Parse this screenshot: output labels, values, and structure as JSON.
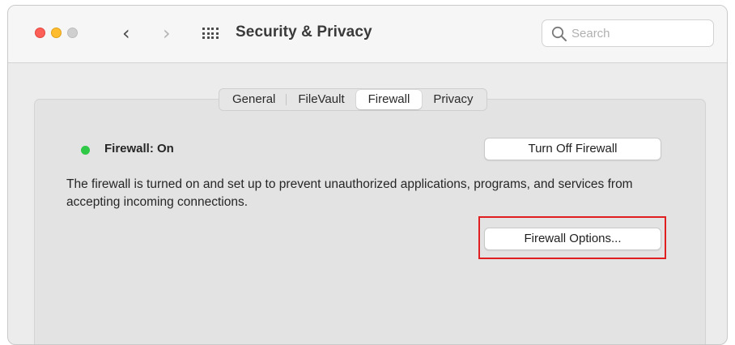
{
  "window": {
    "title": "Security & Privacy"
  },
  "toolbar": {
    "back_icon": "chevron-left-icon",
    "forward_icon": "chevron-right-icon",
    "show_all_icon": "grid-icon",
    "search": {
      "placeholder": "Search",
      "icon": "search-icon"
    }
  },
  "tabs": [
    {
      "label": "General"
    },
    {
      "label": "FileVault"
    },
    {
      "label": "Firewall"
    },
    {
      "label": "Privacy"
    }
  ],
  "active_tab": "Firewall",
  "firewall": {
    "status_label": "Firewall: On",
    "status_color": "#2fc947",
    "toggle_button_label": "Turn Off Firewall",
    "description": "The firewall is turned on and set up to prevent unauthorized applications, programs, and services from accepting incoming connections.",
    "options_button_label": "Firewall Options..."
  },
  "colors": {
    "highlight_border": "#e02020",
    "close": "#fe5f57",
    "minimize": "#febc2e",
    "zoom_inactive": "#cfcfcf"
  }
}
